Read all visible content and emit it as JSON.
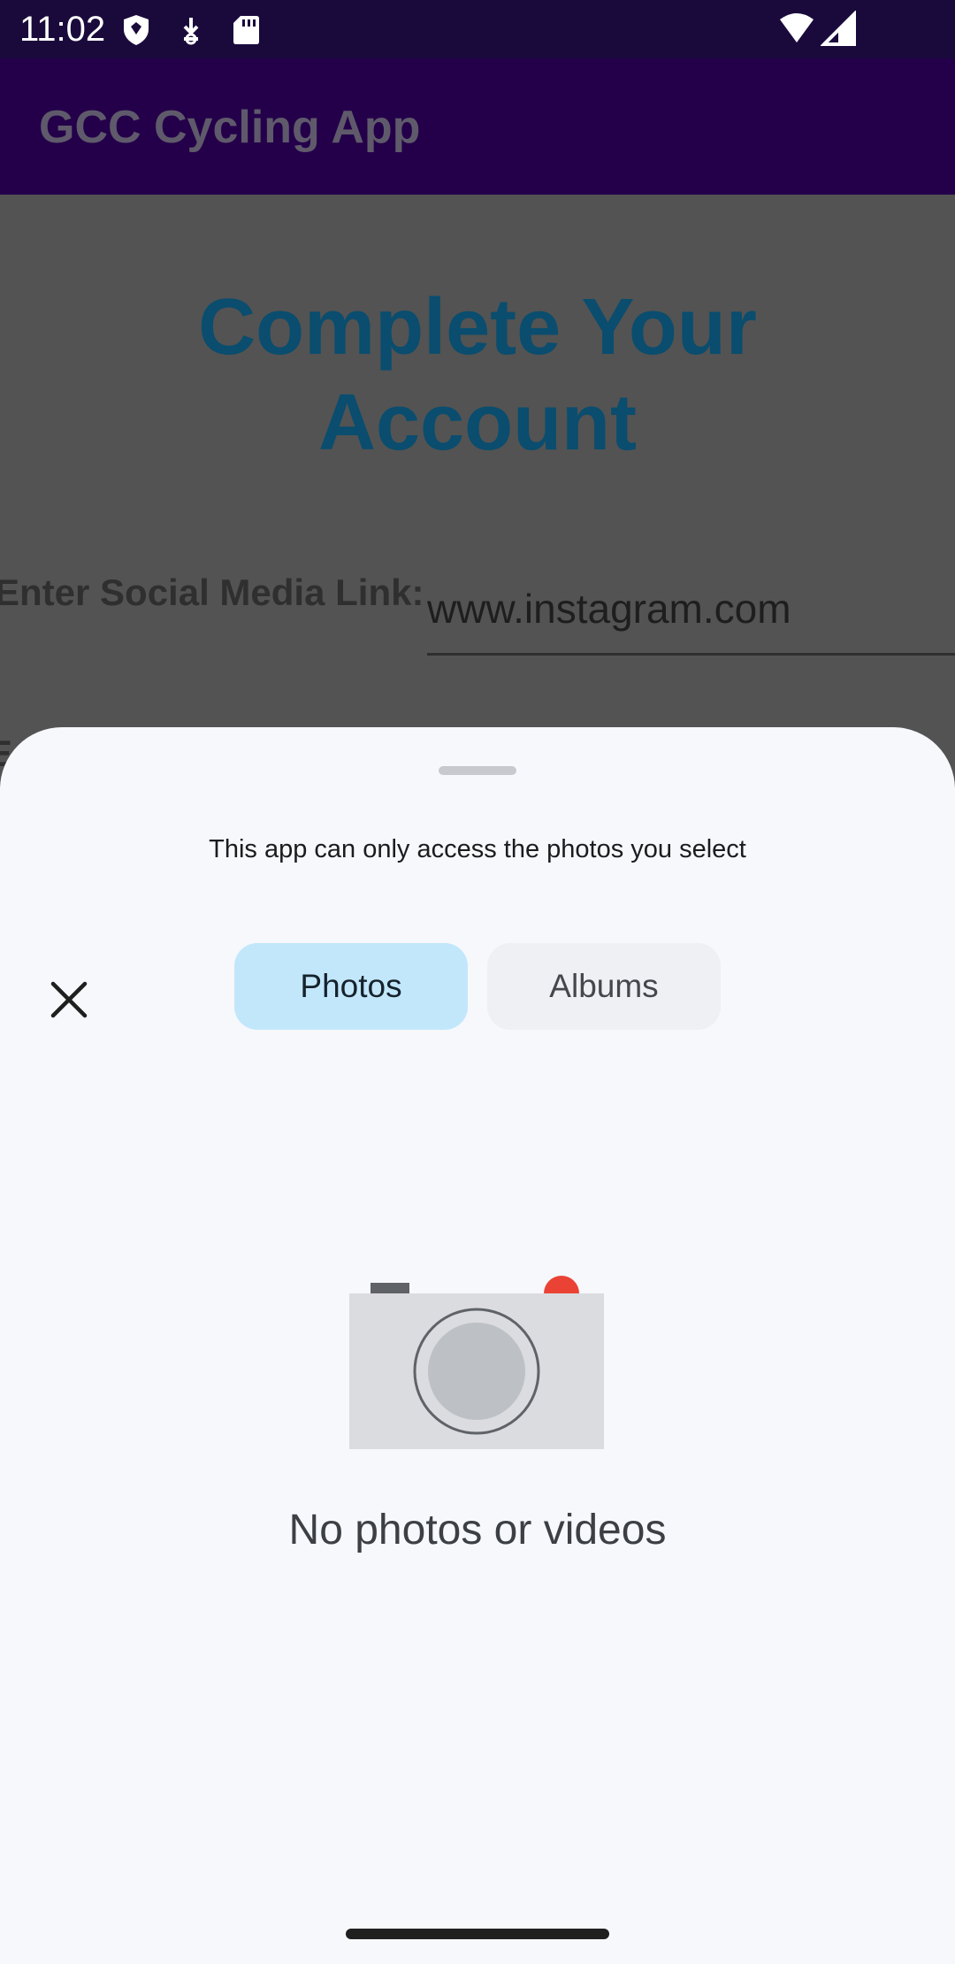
{
  "status_bar": {
    "time": "11:02",
    "left_icons": [
      "shield-icon",
      "download-icon",
      "sd-card-icon"
    ],
    "right_icons": [
      "wifi-icon",
      "signal-icon"
    ]
  },
  "app_bar": {
    "title": "GCC Cycling App"
  },
  "page": {
    "heading": "Complete Your Account",
    "social_label": "Enter Social Media Link:",
    "social_value": "www.instagram.com",
    "partial_label_char": "E"
  },
  "photo_picker": {
    "notice": "This app can only access the photos you select",
    "close_icon": "close-icon",
    "tabs": [
      {
        "label": "Photos",
        "selected": true
      },
      {
        "label": "Albums",
        "selected": false
      }
    ],
    "empty_icon": "camera-icon",
    "empty_message": "No photos or videos"
  },
  "colors": {
    "status_bar": "#1a0a3c",
    "app_bar": "#24004a",
    "scrim": "#535353",
    "heading": "#0a4d6e",
    "sheet_bg": "#f6f8fc",
    "tab_selected": "#c2e7fb",
    "tab_unselected": "#eef0f3",
    "camera_red_dot": "#ea4335"
  }
}
